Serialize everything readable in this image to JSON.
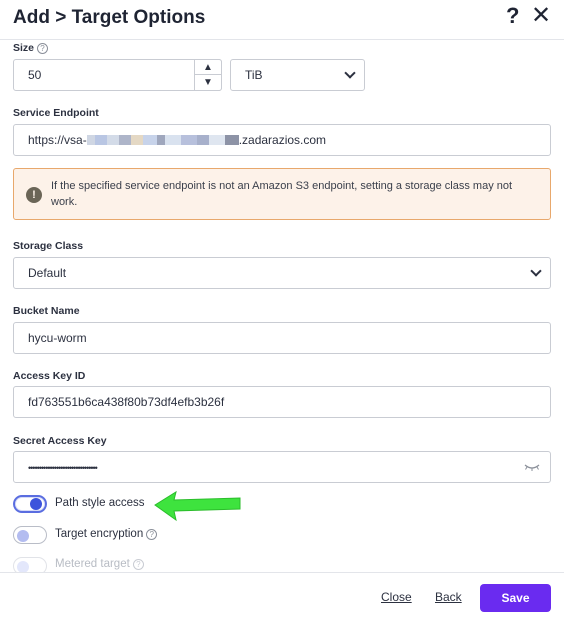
{
  "header": {
    "title": "Add > Target Options",
    "help_glyph": "?",
    "close_glyph": "✕"
  },
  "form": {
    "size": {
      "label": "Size",
      "value": "50",
      "unit": "TiB"
    },
    "service_endpoint": {
      "label": "Service Endpoint",
      "value_prefix": "https://vsa-",
      "value_suffix": ".zadarazios.com"
    },
    "warning": {
      "text": "If the specified service endpoint is not an Amazon S3 endpoint, setting a storage class may not work."
    },
    "storage_class": {
      "label": "Storage Class",
      "value": "Default"
    },
    "bucket_name": {
      "label": "Bucket Name",
      "value": "hycu-worm"
    },
    "access_key_id": {
      "label": "Access Key ID",
      "value": "fd763551b6ca438f80b73df4efb3b26f"
    },
    "secret_access_key": {
      "label": "Secret Access Key",
      "value": "••••••••••••••••••••••••••••••••"
    },
    "toggles": [
      {
        "label": "Path style access",
        "state": "on"
      },
      {
        "label": "Target encryption",
        "state": "off"
      },
      {
        "label": "Metered target",
        "state": "disabled"
      }
    ]
  },
  "footer": {
    "close_label": "Close",
    "back_label": "Back",
    "save_label": "Save"
  },
  "colors": {
    "accent": "#6a2bf0",
    "toggle_on": "#3d54dc",
    "warning_bg": "#fdf2e9",
    "warning_border": "#e8a86c",
    "annotation_arrow": "#3ee33e"
  },
  "icons": [
    "help-icon",
    "close-icon",
    "info-icon",
    "chevron-down-icon",
    "warning-icon",
    "eye-closed-icon",
    "arrow-annotation"
  ]
}
